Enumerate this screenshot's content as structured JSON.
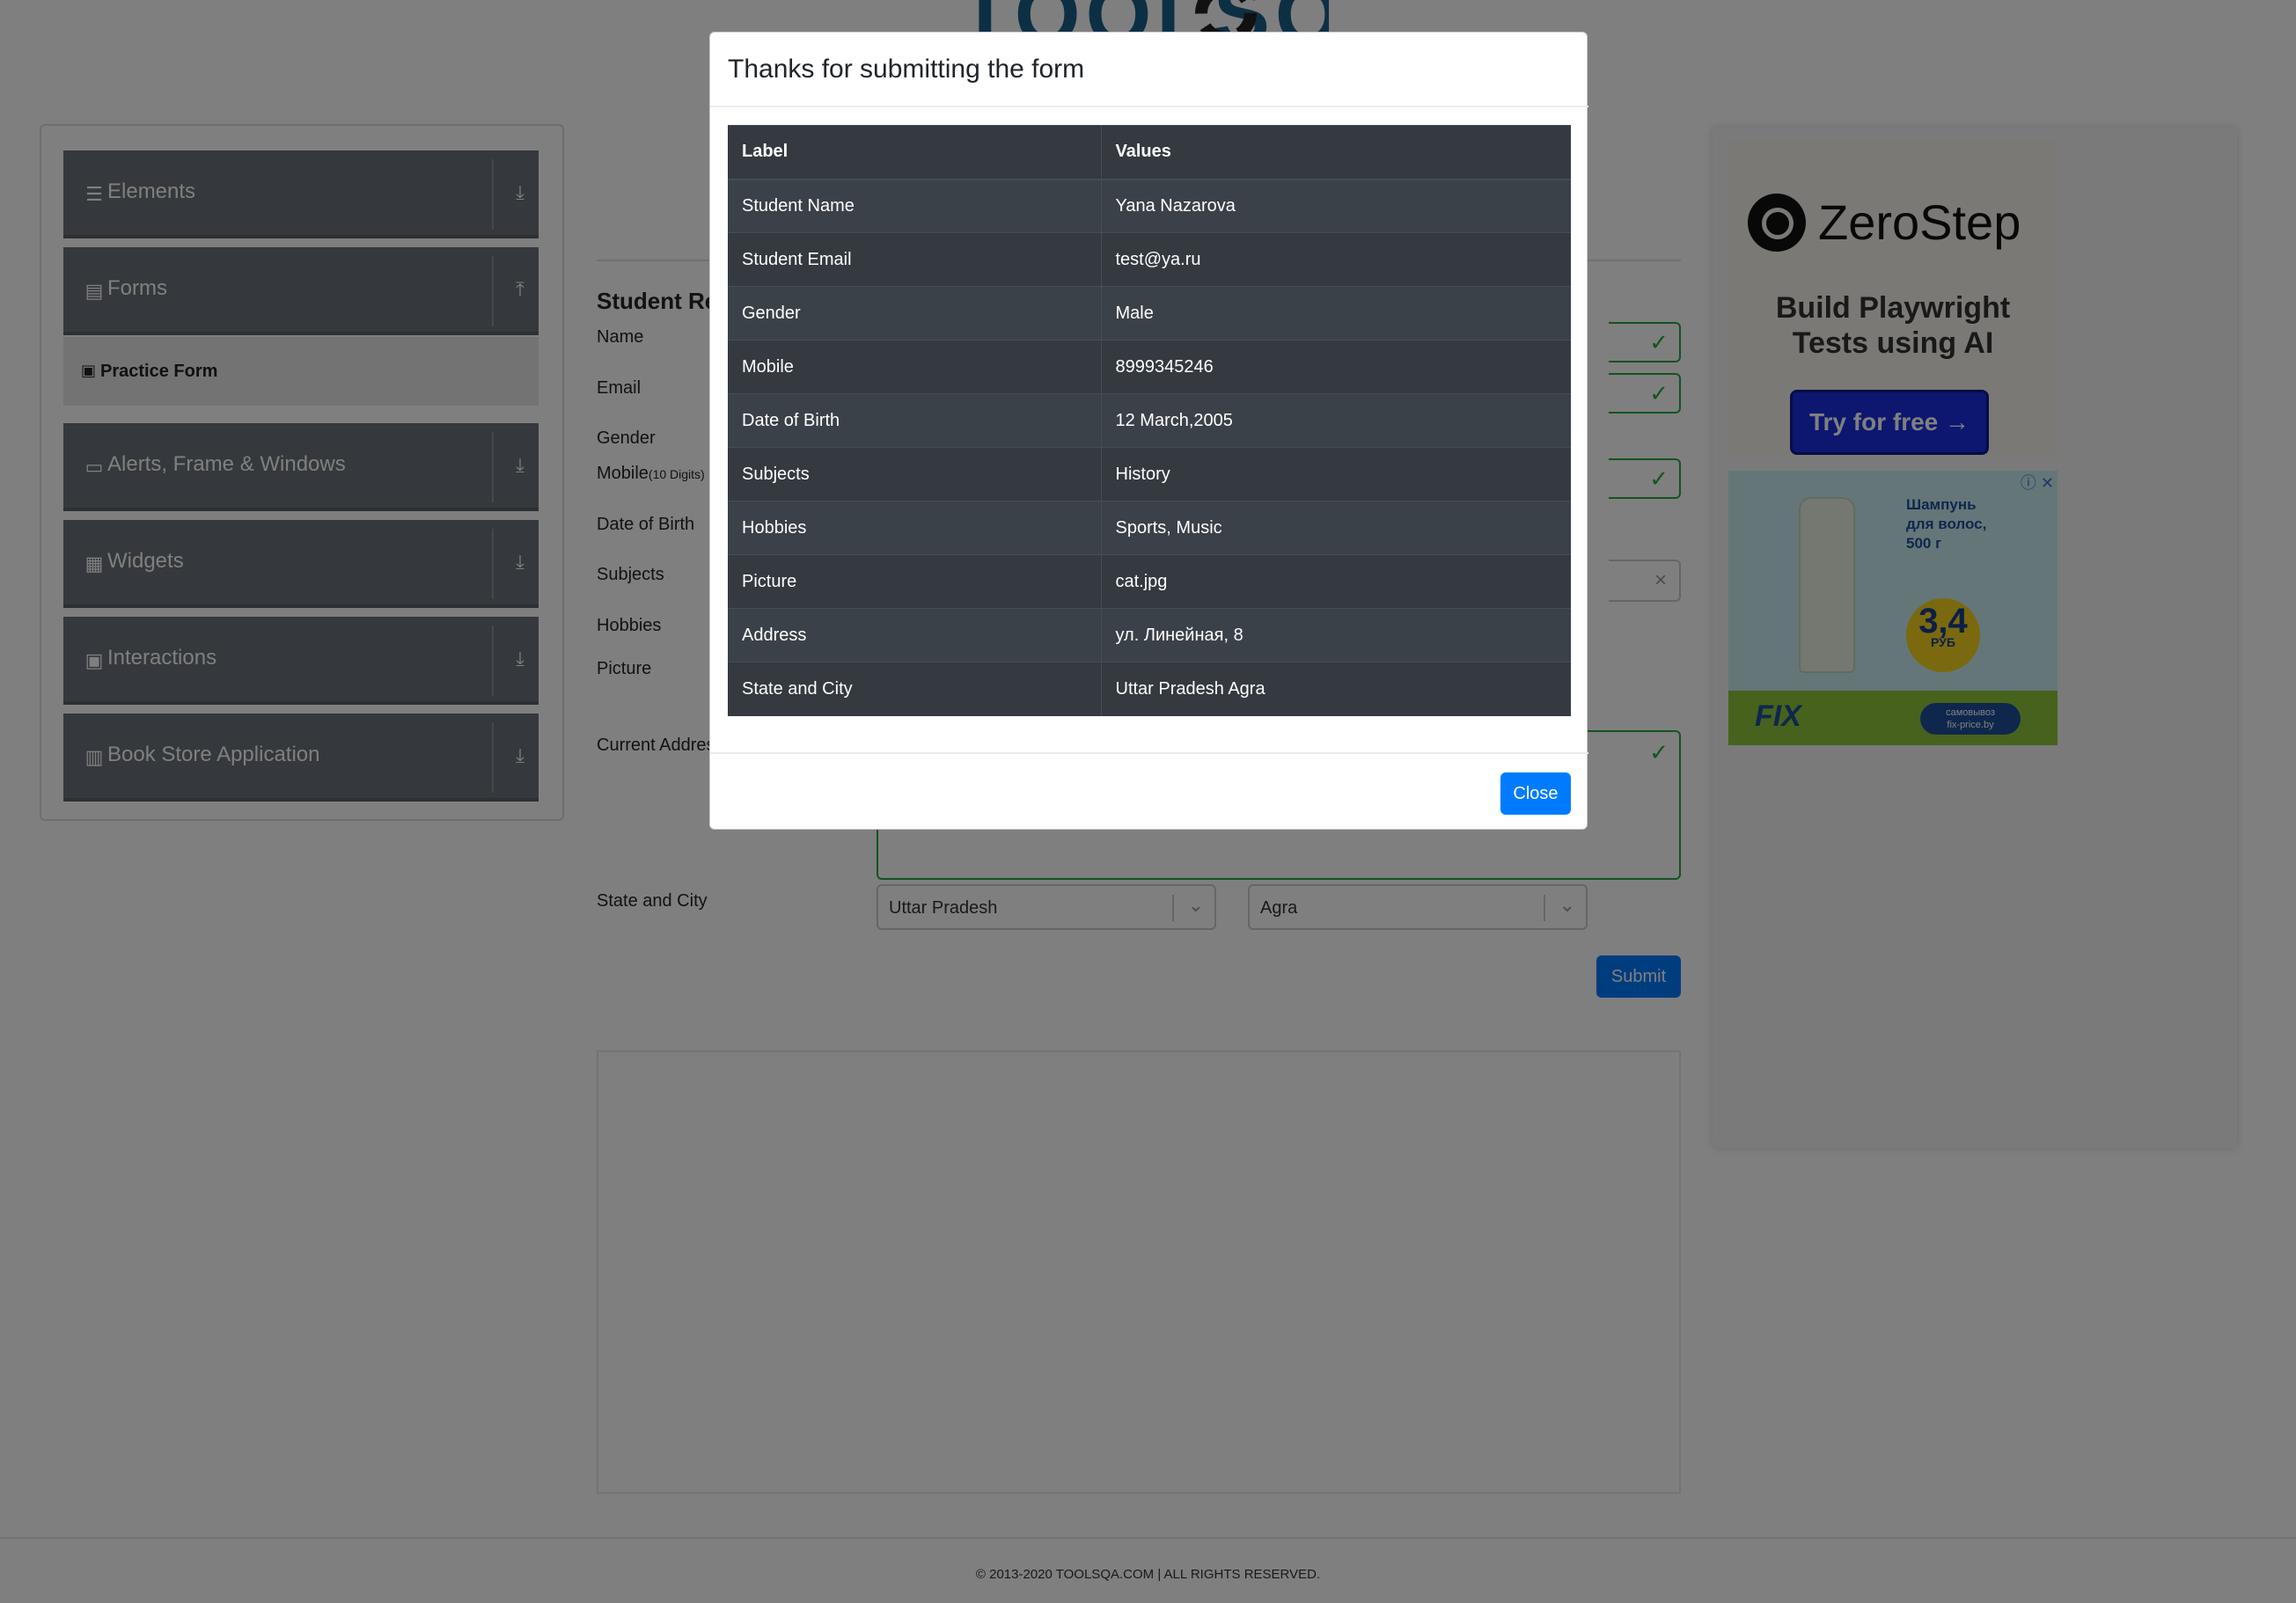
{
  "header": {
    "logo_text": "TOOLSQA"
  },
  "sidebar": {
    "groups": [
      {
        "label": "Elements",
        "icon": "hamburger-icon",
        "arrow": "download-icon"
      },
      {
        "label": "Forms",
        "icon": "document-icon",
        "arrow": "upload-icon"
      },
      {
        "label": "Alerts, Frame & Windows",
        "icon": "window-icon",
        "arrow": "download-icon"
      },
      {
        "label": "Widgets",
        "icon": "widgets-icon",
        "arrow": "download-icon"
      },
      {
        "label": "Interactions",
        "icon": "interactions-icon",
        "arrow": "download-icon"
      },
      {
        "label": "Book Store Application",
        "icon": "books-icon",
        "arrow": "download-icon"
      }
    ],
    "active_item": "Practice Form"
  },
  "form": {
    "title": "Student Registration Form",
    "labels": {
      "name": "Name",
      "email": "Email",
      "gender": "Gender",
      "mobile": "Mobile",
      "mobile_hint": "(10 Digits)",
      "dob": "Date of Birth",
      "subjects": "Subjects",
      "hobbies": "Hobbies",
      "picture": "Picture",
      "address": "Current Address",
      "state_city": "State and City"
    },
    "state_value": "Uttar Pradesh",
    "city_value": "Agra",
    "submit_label": "Submit"
  },
  "ads": {
    "zerostep": {
      "name": "ZeroStep",
      "tagline_1": "Build Playwright",
      "tagline_2": "Tests using AI",
      "button": "Try for free →"
    },
    "fixprice": {
      "line_1": "Шампунь",
      "line_2": "для волос,",
      "line_3": "500 г",
      "price": "3,4",
      "currency": "РУБ",
      "brand": "FIX",
      "pill_1": "самовывоз",
      "pill_2": "fix-price.by"
    }
  },
  "footer": {
    "text": "© 2013-2020 TOOLSQA.COM | ALL RIGHTS RESERVED."
  },
  "modal": {
    "title": "Thanks for submitting the form",
    "headers": {
      "label": "Label",
      "values": "Values"
    },
    "rows": [
      {
        "label": "Student Name",
        "value": "Yana Nazarova"
      },
      {
        "label": "Student Email",
        "value": "test@ya.ru"
      },
      {
        "label": "Gender",
        "value": "Male"
      },
      {
        "label": "Mobile",
        "value": "8999345246"
      },
      {
        "label": "Date of Birth",
        "value": "12 March,2005"
      },
      {
        "label": "Subjects",
        "value": "History"
      },
      {
        "label": "Hobbies",
        "value": "Sports, Music"
      },
      {
        "label": "Picture",
        "value": "cat.jpg"
      },
      {
        "label": "Address",
        "value": "ул. Линейная, 8"
      },
      {
        "label": "State and City",
        "value": "Uttar Pradesh Agra"
      }
    ],
    "close_label": "Close"
  },
  "colors": {
    "primary": "#007bff",
    "table_dark": "#343a40",
    "valid": "#28a745"
  }
}
